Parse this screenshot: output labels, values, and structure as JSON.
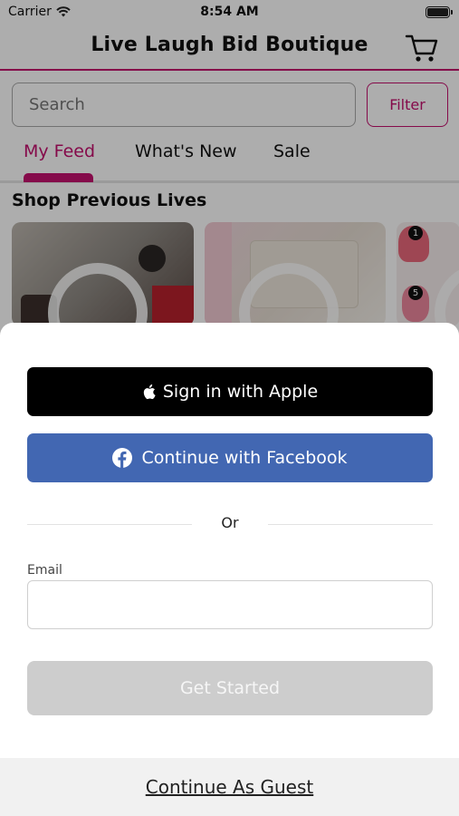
{
  "status_bar": {
    "carrier": "Carrier",
    "time": "8:54 AM"
  },
  "header": {
    "title": "Live Laugh Bid Boutique"
  },
  "search": {
    "placeholder": "Search",
    "filter_label": "Filter"
  },
  "tabs": [
    {
      "label": "My Feed",
      "active": true
    },
    {
      "label": "What's New",
      "active": false
    },
    {
      "label": "Sale",
      "active": false
    }
  ],
  "section": {
    "title": "Shop Previous Lives"
  },
  "thumbnail_badges": [
    "1",
    "5"
  ],
  "sheet": {
    "apple_label": "Sign in with Apple",
    "facebook_label": "Continue with Facebook",
    "or_label": "Or",
    "email_label": "Email",
    "email_value": "",
    "get_started_label": "Get Started",
    "guest_label": "Continue As Guest"
  },
  "colors": {
    "accent": "#c4106e",
    "facebook": "#4267b2",
    "apple": "#000000",
    "disabled_button": "#cdcdcd"
  },
  "icons": [
    "wifi-icon",
    "battery-icon",
    "cart-icon",
    "play-icon",
    "apple-icon",
    "facebook-icon"
  ]
}
